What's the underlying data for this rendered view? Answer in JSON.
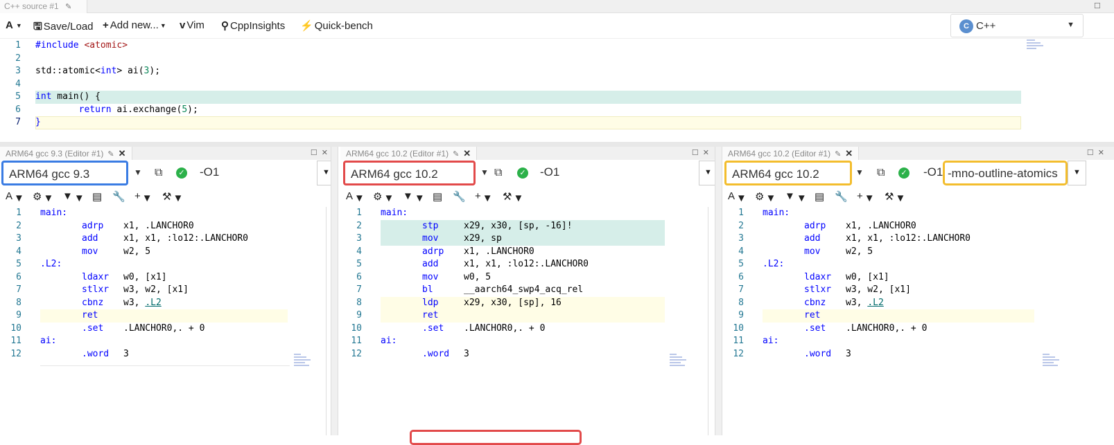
{
  "editor": {
    "tab_title": "C++ source #1",
    "toolbar": {
      "font_label": "A",
      "save_load": "Save/Load",
      "add_new": "Add new...",
      "vim": "Vim",
      "cppinsights": "CppInsights",
      "quickbench": "Quick-bench"
    },
    "language": "C++",
    "language_logo": "C",
    "lines": [
      {
        "n": "1"
      },
      {
        "n": "2"
      },
      {
        "n": "3"
      },
      {
        "n": "4"
      },
      {
        "n": "5"
      },
      {
        "n": "6"
      },
      {
        "n": "7"
      }
    ],
    "code": {
      "l1_pp": "#include",
      "l1_hdr": "<atomic>",
      "l3_a": "std::atomic<",
      "l3_type": "int",
      "l3_b": "> ai(",
      "l3_num": "3",
      "l3_c": ");",
      "l5_kw": "int",
      "l5_rest": " main() {",
      "l6_kw": "return",
      "l6_a": " ai.exchange(",
      "l6_num": "5",
      "l6_b": ");",
      "l7": "}"
    }
  },
  "panes": [
    {
      "tab_title": "ARM64 gcc 9.3 (Editor #1)",
      "compiler": "ARM64 gcc 9.3",
      "options": "-O1",
      "highlight": "blue",
      "asm": [
        {
          "n": "1",
          "label": "main:",
          "op": "",
          "args": ""
        },
        {
          "n": "2",
          "label": "",
          "op": "adrp",
          "args": "x1, .LANCHOR0"
        },
        {
          "n": "3",
          "label": "",
          "op": "add",
          "args": "x1, x1, :lo12:.LANCHOR0"
        },
        {
          "n": "4",
          "label": "",
          "op": "mov",
          "args": "w2, 5"
        },
        {
          "n": "5",
          "label": ".L2:",
          "op": "",
          "args": ""
        },
        {
          "n": "6",
          "label": "",
          "op": "ldaxr",
          "args": "w0, [x1]"
        },
        {
          "n": "7",
          "label": "",
          "op": "stlxr",
          "args": "w3, w2, [x1]"
        },
        {
          "n": "8",
          "label": "",
          "op": "cbnz",
          "args": "w3, ",
          "link": ".L2"
        },
        {
          "n": "9",
          "label": "",
          "op": "ret",
          "args": ""
        },
        {
          "n": "10",
          "label": "",
          "op": ".set",
          "args": ".LANCHOR0,. + 0"
        },
        {
          "n": "11",
          "label": "ai:",
          "op": "",
          "args": ""
        },
        {
          "n": "12",
          "label": "",
          "op": ".word",
          "args": "3"
        }
      ]
    },
    {
      "tab_title": "ARM64 gcc 10.2 (Editor #1)",
      "compiler": "ARM64 gcc 10.2",
      "options": "-O1",
      "highlight": "red",
      "asm": [
        {
          "n": "1",
          "label": "main:",
          "op": "",
          "args": ""
        },
        {
          "n": "2",
          "label": "",
          "op": "stp",
          "args": "x29, x30, [sp, -16]!"
        },
        {
          "n": "3",
          "label": "",
          "op": "mov",
          "args": "x29, sp"
        },
        {
          "n": "4",
          "label": "",
          "op": "adrp",
          "args": "x1, .LANCHOR0"
        },
        {
          "n": "5",
          "label": "",
          "op": "add",
          "args": "x1, x1, :lo12:.LANCHOR0"
        },
        {
          "n": "6",
          "label": "",
          "op": "mov",
          "args": "w0, 5"
        },
        {
          "n": "7",
          "label": "",
          "op": "bl",
          "args": "__aarch64_swp4_acq_rel"
        },
        {
          "n": "8",
          "label": "",
          "op": "ldp",
          "args": "x29, x30, [sp], 16"
        },
        {
          "n": "9",
          "label": "",
          "op": "ret",
          "args": ""
        },
        {
          "n": "10",
          "label": "",
          "op": ".set",
          "args": ".LANCHOR0,. + 0"
        },
        {
          "n": "11",
          "label": "ai:",
          "op": "",
          "args": ""
        },
        {
          "n": "12",
          "label": "",
          "op": ".word",
          "args": "3"
        }
      ]
    },
    {
      "tab_title": "ARM64 gcc 10.2 (Editor #1)",
      "compiler": "ARM64 gcc 10.2",
      "options": "-O1",
      "extra_options": "-mno-outline-atomics",
      "highlight": "yellow",
      "asm": [
        {
          "n": "1",
          "label": "main:",
          "op": "",
          "args": ""
        },
        {
          "n": "2",
          "label": "",
          "op": "adrp",
          "args": "x1, .LANCHOR0"
        },
        {
          "n": "3",
          "label": "",
          "op": "add",
          "args": "x1, x1, :lo12:.LANCHOR0"
        },
        {
          "n": "4",
          "label": "",
          "op": "mov",
          "args": "w2, 5"
        },
        {
          "n": "5",
          "label": ".L2:",
          "op": "",
          "args": ""
        },
        {
          "n": "6",
          "label": "",
          "op": "ldaxr",
          "args": "w0, [x1]"
        },
        {
          "n": "7",
          "label": "",
          "op": "stlxr",
          "args": "w3, w2, [x1]"
        },
        {
          "n": "8",
          "label": "",
          "op": "cbnz",
          "args": "w3, ",
          "link": ".L2"
        },
        {
          "n": "9",
          "label": "",
          "op": "ret",
          "args": ""
        },
        {
          "n": "10",
          "label": "",
          "op": ".set",
          "args": ".LANCHOR0,. + 0"
        },
        {
          "n": "11",
          "label": "ai:",
          "op": "",
          "args": ""
        },
        {
          "n": "12",
          "label": "",
          "op": ".word",
          "args": "3"
        }
      ]
    }
  ],
  "colors": {
    "highlight_blue": "#3a7ce3",
    "highlight_red": "#e24a4a",
    "highlight_yellow": "#f3bd2d",
    "line_teal": "#d6eee9",
    "line_yellow": "#fffde6"
  },
  "icons": [
    "font-size-icon",
    "save-icon",
    "plus-icon",
    "vim-icon",
    "cppinsights-icon",
    "quickbench-icon",
    "popout-icon",
    "check-ok-icon",
    "settings-icon",
    "filter-icon",
    "book-icon",
    "wrench-icon",
    "tool-icon"
  ]
}
